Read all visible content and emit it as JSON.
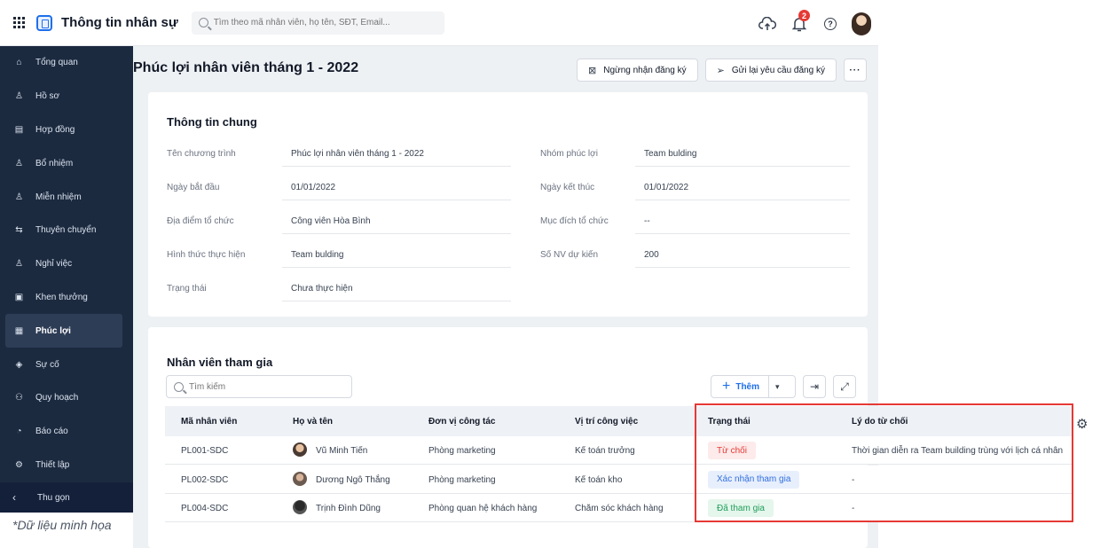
{
  "topbar": {
    "app_title": "Thông tin nhân sự",
    "search_placeholder": "Tìm theo mã nhân viên, họ tên, SĐT, Email...",
    "notification_count": "2"
  },
  "sidebar": {
    "items": [
      {
        "label": "Tổng quan",
        "icon": "home-icon"
      },
      {
        "label": "Hồ sơ",
        "icon": "person-icon"
      },
      {
        "label": "Hợp đồng",
        "icon": "document-icon"
      },
      {
        "label": "Bổ nhiệm",
        "icon": "person-add-icon"
      },
      {
        "label": "Miễn nhiệm",
        "icon": "person-remove-icon"
      },
      {
        "label": "Thuyên chuyển",
        "icon": "transfer-icon"
      },
      {
        "label": "Nghỉ việc",
        "icon": "person-leave-icon"
      },
      {
        "label": "Khen thưởng",
        "icon": "reward-icon"
      },
      {
        "label": "Phúc lợi",
        "icon": "welfare-icon"
      },
      {
        "label": "Sự cố",
        "icon": "shield-icon"
      },
      {
        "label": "Quy hoạch",
        "icon": "people-icon"
      },
      {
        "label": "Báo cáo",
        "icon": "chart-icon"
      },
      {
        "label": "Thiết lập",
        "icon": "gear-icon"
      }
    ],
    "active_index": 8,
    "collapse_label": "Thu gọn",
    "caption": "*Dữ liệu minh họa"
  },
  "page": {
    "title": "Phúc lợi nhân viên tháng 1 - 2022",
    "actions": {
      "stop_label": "Ngừng nhận đăng ký",
      "resend_label": "Gửi lại yêu cầu đăng ký",
      "more_label": "···"
    }
  },
  "general": {
    "title": "Thông tin chung",
    "left": [
      {
        "label": "Tên chương trình",
        "value": "Phúc lợi nhân viên tháng 1 - 2022"
      },
      {
        "label": "Ngày bắt đầu",
        "value": "01/01/2022"
      },
      {
        "label": "Địa điểm tổ chức",
        "value": "Công viên Hòa Bình"
      },
      {
        "label": "Hình thức thực hiện",
        "value": "Team bulding"
      },
      {
        "label": "Trạng thái",
        "value": "Chưa thực hiện"
      }
    ],
    "right": [
      {
        "label": "Nhóm phúc lợi",
        "value": "Team bulding"
      },
      {
        "label": "Ngày kết thúc",
        "value": "01/01/2022"
      },
      {
        "label": "Mục đích tổ chức",
        "value": "--"
      },
      {
        "label": "Số NV dự kiến",
        "value": "200"
      }
    ]
  },
  "participants": {
    "title": "Nhân viên tham gia",
    "search_placeholder": "Tìm kiếm",
    "add_label": "Thêm",
    "columns": [
      "Mã nhân viên",
      "Họ và tên",
      "Đơn vị công tác",
      "Vị trí công việc",
      "Trạng thái",
      "Lý do từ chối"
    ],
    "rows": [
      {
        "id": "PL001-SDC",
        "name": "Vũ Minh Tiến",
        "unit": "Phòng marketing",
        "position": "Kế toán trưởng",
        "status": "Từ chối",
        "status_color": "#e53935",
        "status_bg": "#fdeaea",
        "reason": "Thời gian diễn ra Team building trùng với lịch cá nhân"
      },
      {
        "id": "PL002-SDC",
        "name": "Dương Ngô Thắng",
        "unit": "Phòng marketing",
        "position": "Kế toán kho",
        "status": "Xác nhận tham gia",
        "status_color": "#2f6fe0",
        "status_bg": "#e8effc",
        "reason": "-"
      },
      {
        "id": "PL004-SDC",
        "name": "Trịnh Đình Dũng",
        "unit": "Phòng quan hệ khách hàng",
        "position": "Chăm sóc khách hàng",
        "status": "Đã tham gia",
        "status_color": "#1e9e5a",
        "status_bg": "#e5f6ec",
        "reason": "-"
      }
    ]
  },
  "colors": {
    "sidebar_bg": "#1c2a40",
    "accent": "#1f6feb",
    "highlight": "#e53935"
  }
}
